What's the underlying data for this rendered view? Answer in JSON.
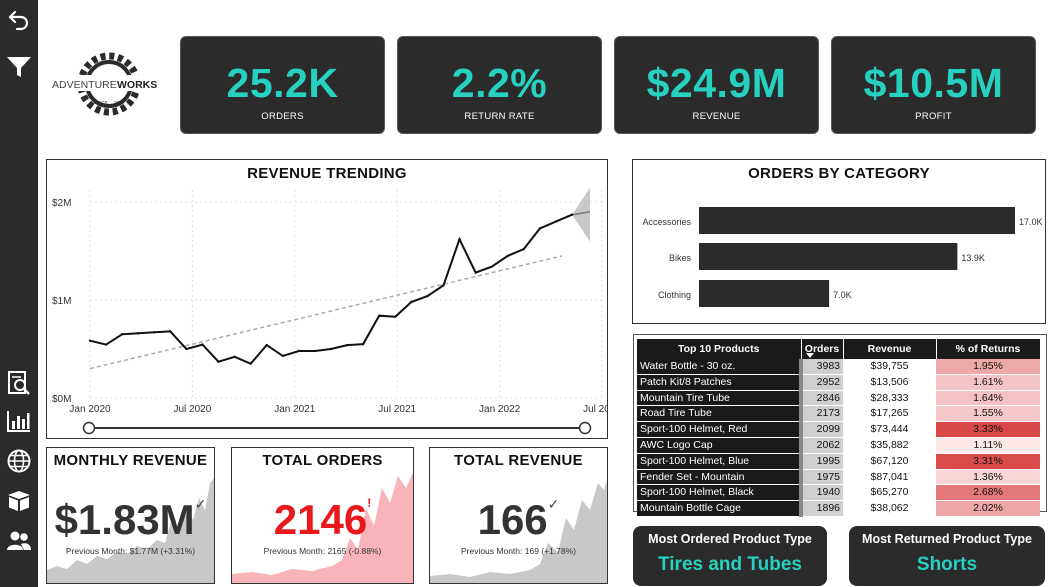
{
  "logo": {
    "brand_left": "ADVENTURE",
    "brand_right": "WORKS",
    "since_left": "SINCE",
    "since_right": "2000"
  },
  "kpis": [
    {
      "value": "25.2K",
      "label": "ORDERS"
    },
    {
      "value": "2.2%",
      "label": "RETURN RATE"
    },
    {
      "value": "$24.9M",
      "label": "REVENUE"
    },
    {
      "value": "$10.5M",
      "label": "PROFIT"
    }
  ],
  "revenue_trending": {
    "title": "REVENUE TRENDING",
    "chart_data": {
      "type": "line",
      "title": "REVENUE TRENDING",
      "x_tick_labels": [
        "Jan 2020",
        "Jul 2020",
        "Jan 2021",
        "Jul 2021",
        "Jan 2022",
        "Jul 2022"
      ],
      "y_tick_labels": [
        "$0M",
        "$1M",
        "$2M"
      ],
      "ylim": [
        0,
        2000000
      ],
      "series": [
        {
          "values": [
            585000,
            545000,
            650000,
            660000,
            670000,
            680000,
            500000,
            545000,
            370000,
            420000,
            350000,
            540000,
            430000,
            480000,
            480000,
            500000,
            540000,
            550000,
            840000,
            830000,
            980000,
            1040000,
            1150000,
            1620000,
            1280000,
            1340000,
            1450000,
            1520000,
            1730000,
            1800000,
            1870000
          ]
        }
      ],
      "forecast_end": 1900000,
      "trend_start": 300000,
      "trend_end": 1450000,
      "grid": true
    }
  },
  "orders_by_category": {
    "title": "ORDERS BY CATEGORY",
    "chart_data": {
      "type": "bar",
      "orientation": "horizontal",
      "title": "ORDERS BY CATEGORY",
      "categories": [
        "Accessories",
        "Bikes",
        "Clothing"
      ],
      "values": [
        17000,
        13900,
        7000
      ],
      "value_labels": [
        "17.0K",
        "13.9K",
        "7.0K"
      ],
      "color": "#2b2b2b"
    }
  },
  "top10": {
    "headers": [
      "Top 10 Products",
      "Orders",
      "Revenue",
      "% of Returns"
    ],
    "rows": [
      {
        "product": "Water Bottle - 30 oz.",
        "orders": "3983",
        "revenue": "$39,755",
        "returns": "1.95%",
        "heat": 0.4
      },
      {
        "product": "Patch Kit/8 Patches",
        "orders": "2952",
        "revenue": "$13,506",
        "returns": "1.61%",
        "heat": 0.22
      },
      {
        "product": "Mountain Tire Tube",
        "orders": "2846",
        "revenue": "$28,333",
        "returns": "1.64%",
        "heat": 0.24
      },
      {
        "product": "Road Tire Tube",
        "orders": "2173",
        "revenue": "$17,265",
        "returns": "1.55%",
        "heat": 0.2
      },
      {
        "product": "Sport-100 Helmet, Red",
        "orders": "2099",
        "revenue": "$73,444",
        "returns": "3.33%",
        "heat": 1.0
      },
      {
        "product": "AWC Logo Cap",
        "orders": "2062",
        "revenue": "$35,882",
        "returns": "1.11%",
        "heat": 0.0
      },
      {
        "product": "Sport-100 Helmet, Blue",
        "orders": "1995",
        "revenue": "$67,120",
        "returns": "3.31%",
        "heat": 0.98
      },
      {
        "product": "Fender Set - Mountain",
        "orders": "1975",
        "revenue": "$87,041",
        "returns": "1.36%",
        "heat": 0.12
      },
      {
        "product": "Sport-100 Helmet, Black",
        "orders": "1940",
        "revenue": "$65,270",
        "returns": "2.68%",
        "heat": 0.7
      },
      {
        "product": "Mountain Bottle Cage",
        "orders": "1896",
        "revenue": "$38,062",
        "returns": "2.02%",
        "heat": 0.42
      }
    ]
  },
  "monthly_revenue": {
    "title": "MONTHLY REVENUE",
    "value": "$1.83M",
    "indicator": "✓",
    "previous": "Previous Month: $1.77M (+3.31%)"
  },
  "total_orders": {
    "title": "TOTAL ORDERS",
    "value": "2146",
    "indicator": "!",
    "previous": "Previous Month: 2165 (-0.88%)"
  },
  "total_revenue": {
    "title": "TOTAL REVENUE",
    "value": "166",
    "indicator": "✓",
    "previous": "Previous Month: 169 (+1.78%)"
  },
  "most_ordered": {
    "title": "Most Ordered Product Type",
    "value": "Tires and Tubes"
  },
  "most_returned": {
    "title": "Most Returned Product Type",
    "value": "Shorts"
  },
  "sidebar": {
    "icons": [
      "back-arrow-icon",
      "filter-icon",
      "report-search-icon",
      "bar-chart-icon",
      "globe-icon",
      "box-icon",
      "users-icon"
    ]
  },
  "colors": {
    "accent": "#27d1c0",
    "dark": "#2b2b2b",
    "heat_high": "#d94848",
    "heat_low": "#fde8e8",
    "spark_gray": "#c8c8c8",
    "spark_pink": "#f8b4b8",
    "alert_red": "#e8181c"
  }
}
